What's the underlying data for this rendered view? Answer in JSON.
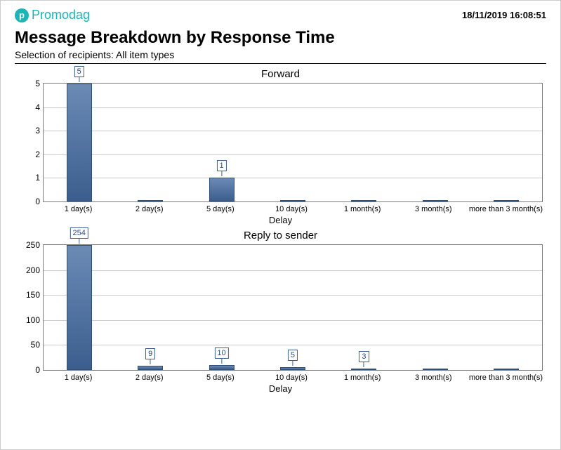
{
  "header": {
    "brand": "Promodag",
    "timestamp": "18/11/2019 16:08:51",
    "title": "Message Breakdown by Response Time",
    "subtitle": "Selection of recipients: All item types"
  },
  "chart_data": [
    {
      "type": "bar",
      "title": "Forward",
      "xlabel": "Delay",
      "ylabel": "",
      "ylim": [
        0,
        5
      ],
      "yticks": [
        0,
        1,
        2,
        3,
        4,
        5
      ],
      "categories": [
        "1 day(s)",
        "2 day(s)",
        "5 day(s)",
        "10 day(s)",
        "1 month(s)",
        "3 month(s)",
        "more than 3 month(s)"
      ],
      "values": [
        5,
        0,
        1,
        0,
        0,
        0,
        0
      ]
    },
    {
      "type": "bar",
      "title": "Reply to sender",
      "xlabel": "Delay",
      "ylabel": "",
      "ylim": [
        0,
        250
      ],
      "yticks": [
        0,
        50,
        100,
        150,
        200,
        250
      ],
      "categories": [
        "1 day(s)",
        "2 day(s)",
        "5 day(s)",
        "10 day(s)",
        "1 month(s)",
        "3 month(s)",
        "more than 3 month(s)"
      ],
      "values": [
        254,
        9,
        10,
        5,
        3,
        0,
        0
      ]
    }
  ]
}
